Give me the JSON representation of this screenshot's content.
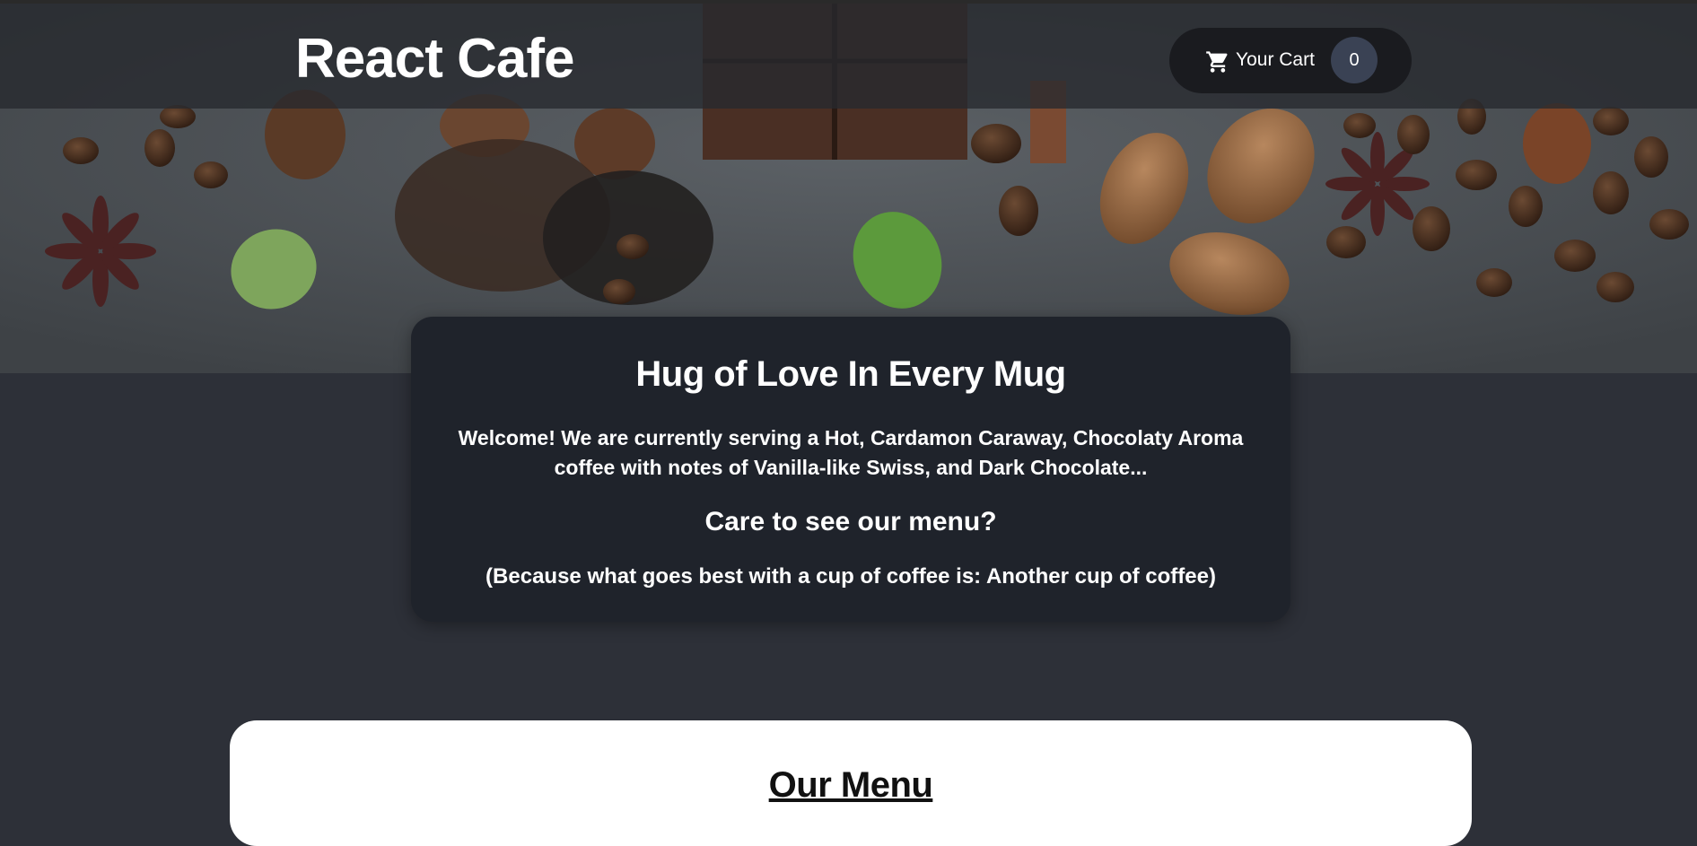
{
  "header": {
    "brand": "React Cafe",
    "cart": {
      "label": "Your Cart",
      "count": "0",
      "icon": "shopping-cart-icon"
    }
  },
  "hero": {
    "image": "coffee-beans-and-spices-photo"
  },
  "summary": {
    "title": "Hug of Love In Every Mug",
    "text": "Welcome! We are currently serving a Hot, Cardamon Caraway, Chocolaty Aroma coffee with notes of Vanilla-like Swiss, and Dark Chocolate...",
    "question": "Care to see our menu?",
    "quote": "(Because what goes best with a cup of coffee is: Another cup of coffee)"
  },
  "menu": {
    "title": "Our Menu"
  },
  "colors": {
    "page_bg": "#2d3038",
    "summary_bg": "#1f232b",
    "cart_bg": "#1a1b1f",
    "badge_bg": "#3a4254",
    "menu_card_bg": "#ffffff"
  }
}
